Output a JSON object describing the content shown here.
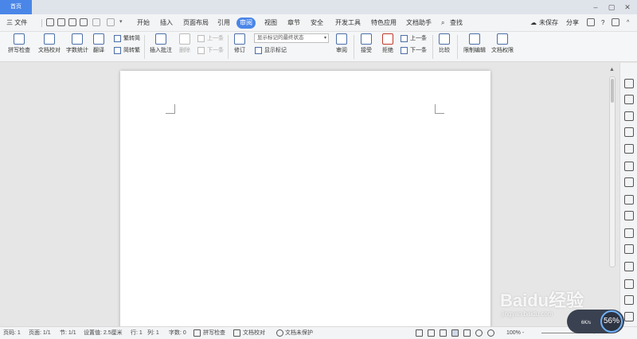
{
  "titlebar": {
    "home_tab": "首页",
    "minimize": "–",
    "maximize": "▢",
    "close": "✕"
  },
  "menubar": {
    "file": "三 文件",
    "tabs": [
      "开始",
      "插入",
      "页面布局",
      "引用",
      "审阅",
      "视图",
      "章节",
      "安全",
      "开发工具",
      "特色应用",
      "文档助手"
    ],
    "active_tab": "审阅",
    "search": "查找",
    "unsaved": "未保存",
    "share": "分享",
    "help": "?"
  },
  "ribbon": {
    "spell_check": "拼写检查",
    "doc_proof": "文档校对",
    "word_count": "字数统计",
    "translate": "翻译",
    "trad_to_simp": "繁转简",
    "simp_to_trad": "简转繁",
    "insert_comment": "插入批注",
    "delete": "删除",
    "prev_comment": "上一条",
    "next_comment": "下一条",
    "track_changes": "修订",
    "markup_state": "显示标记的最终状态",
    "show_markup": "显示标记",
    "review": "审阅",
    "accept": "接受",
    "reject": "拒绝",
    "prev_change": "上一条",
    "next_change": "下一条",
    "compare": "比较",
    "restrict_edit": "限制编辑",
    "doc_permissions": "文档权限"
  },
  "statusbar": {
    "page_num": "页码: 1",
    "pages": "页面: 1/1",
    "section": "节: 1/1",
    "setting": "设置值: 2.5厘米",
    "row": "行: 1",
    "col": "列: 1",
    "word_count": "字数: 0",
    "spell_check": "拼写检查",
    "doc_proof": "文档校对",
    "protection": "文档未保护",
    "zoom": "100% -",
    "zoom_plus": "+"
  },
  "speed_widget": {
    "percent": "56%",
    "rate": "6K/s"
  },
  "watermark": {
    "logo": "Baidu经验",
    "url": "jingyan.baidu.com"
  }
}
